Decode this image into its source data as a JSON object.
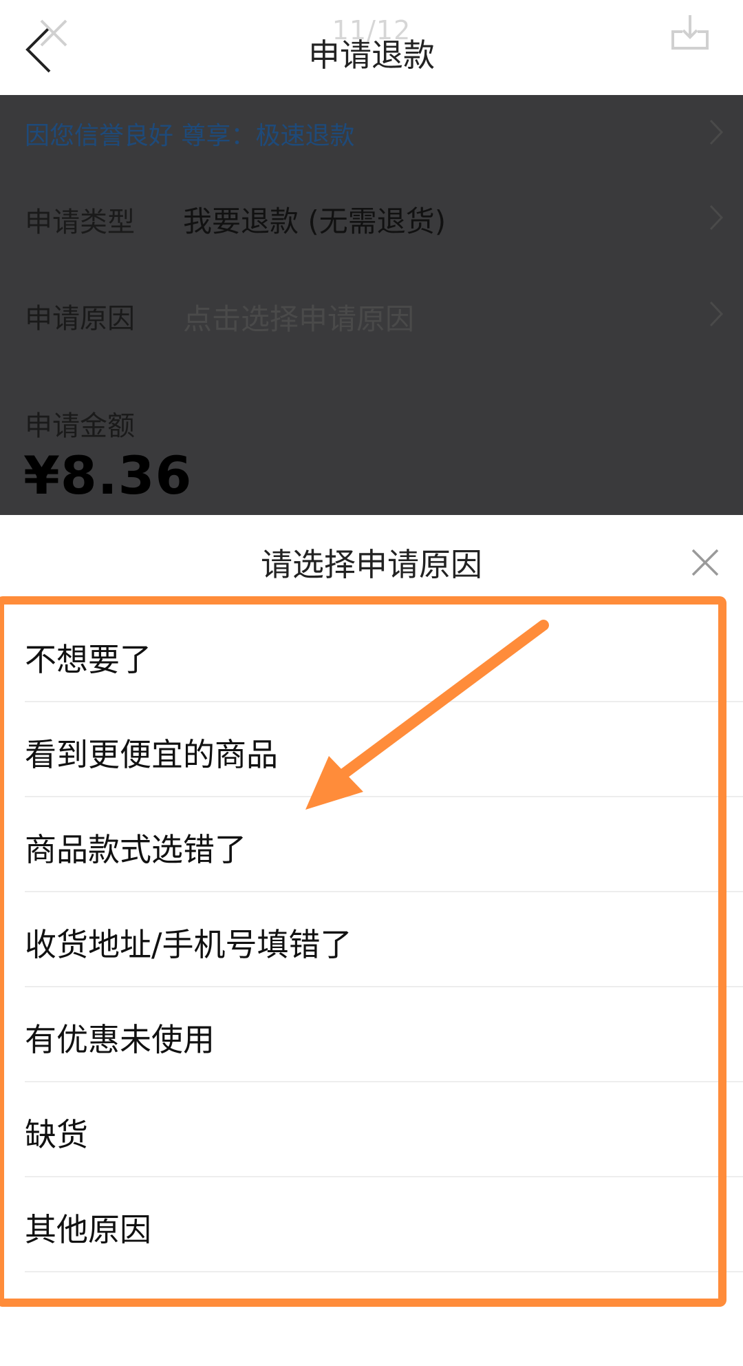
{
  "nav": {
    "page_counter": "11/12",
    "title": "申请退款"
  },
  "form": {
    "credit_notice": "因您信誉良好 尊享：极速退款",
    "type_label": "申请类型",
    "type_value": "我要退款 (无需退货)",
    "reason_label": "申请原因",
    "reason_placeholder": "点击选择申请原因",
    "amount_label": "申请金额",
    "amount_value": "¥8.36"
  },
  "sheet": {
    "title": "请选择申请原因",
    "reasons": [
      "不想要了",
      "看到更便宜的商品",
      "商品款式选错了",
      "收货地址/手机号填错了",
      "有优惠未使用",
      "缺货",
      "其他原因"
    ]
  },
  "icons": {
    "back": "chevron-left-icon",
    "viewer_close": "close-icon",
    "download": "download-icon",
    "row_chevron": "chevron-right-icon",
    "sheet_close": "close-icon"
  },
  "colors": {
    "annotation": "#ff8c3a",
    "credit_text": "#1e4a7a",
    "overlay": "#3a3a3c"
  }
}
